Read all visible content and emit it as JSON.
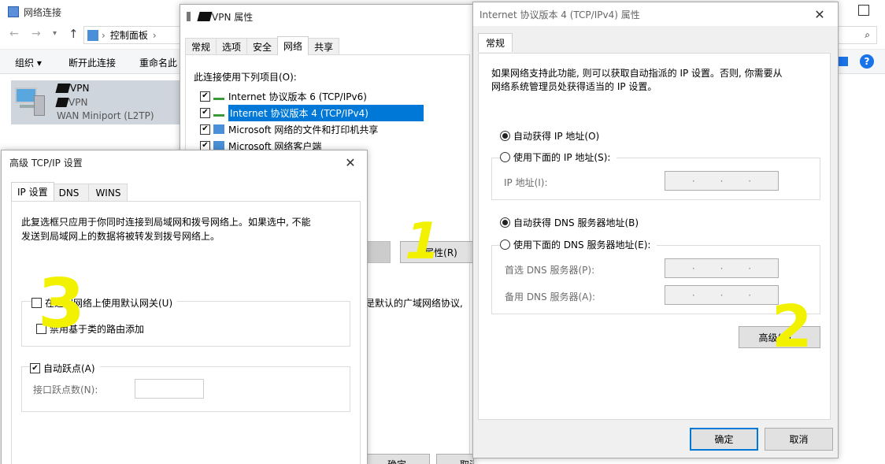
{
  "network_window": {
    "title": "网络连接",
    "address": "控制面板",
    "address_tail": "›",
    "toolbar": [
      "组织 ▾",
      "断开此连接",
      "重命名此"
    ],
    "connection": {
      "name": "VPN",
      "status": "VPN",
      "device": "WAN Miniport (L2TP)"
    }
  },
  "vpn_props": {
    "title": "VPN 属性",
    "tabs": [
      "常规",
      "选项",
      "安全",
      "网络",
      "共享"
    ],
    "list_label": "此连接使用下列项目(O):",
    "items": [
      "Internet 协议版本 6 (TCP/IPv6)",
      "Internet 协议版本 4 (TCP/IPv4)",
      "Microsoft 网络的文件和打印机共享",
      "Microsoft 网络客户端"
    ],
    "properties_button": "属性(R)",
    "desc_fragment": "是默认的广域网络协议,",
    "ok": "确定",
    "cancel": "取消"
  },
  "ipv4_props": {
    "title": "Internet 协议版本 4 (TCP/IPv4) 属性",
    "tab": "常规",
    "desc1": "如果网络支持此功能, 则可以获取自动指派的 IP 设置。否则, 你需要从",
    "desc2": "网络系统管理员处获得适当的 IP 设置。",
    "auto_ip": "自动获得 IP 地址(O)",
    "manual_ip": "使用下面的 IP 地址(S):",
    "ip_label": "IP 地址(I):",
    "auto_dns": "自动获得 DNS 服务器地址(B)",
    "manual_dns": "使用下面的 DNS 服务器地址(E):",
    "pref_dns": "首选 DNS 服务器(P):",
    "alt_dns": "备用 DNS 服务器(A):",
    "advanced": "高级(V)...",
    "ok": "确定",
    "cancel": "取消",
    "ip_dots": "·"
  },
  "adv_tcpip": {
    "title": "高级 TCP/IP 设置",
    "tabs": [
      "IP 设置",
      "DNS",
      "WINS"
    ],
    "desc1": "此复选框只应用于你同时连接到局域网和拨号网络上。如果选中, 不能",
    "desc2": "发送到局域网上的数据将被转发到拨号网络上。",
    "remote_gateway": "在远程网络上使用默认网关(U)",
    "class_route": "禁用基于类的路由添加",
    "auto_metric": "自动跃点(A)",
    "metric_label": "接口跃点数(N):"
  },
  "annotations": [
    "1",
    "2",
    "3"
  ],
  "colors": {
    "annotation": "#f2f200",
    "selection": "#0078d7",
    "help_icon": "#1a73e8"
  }
}
